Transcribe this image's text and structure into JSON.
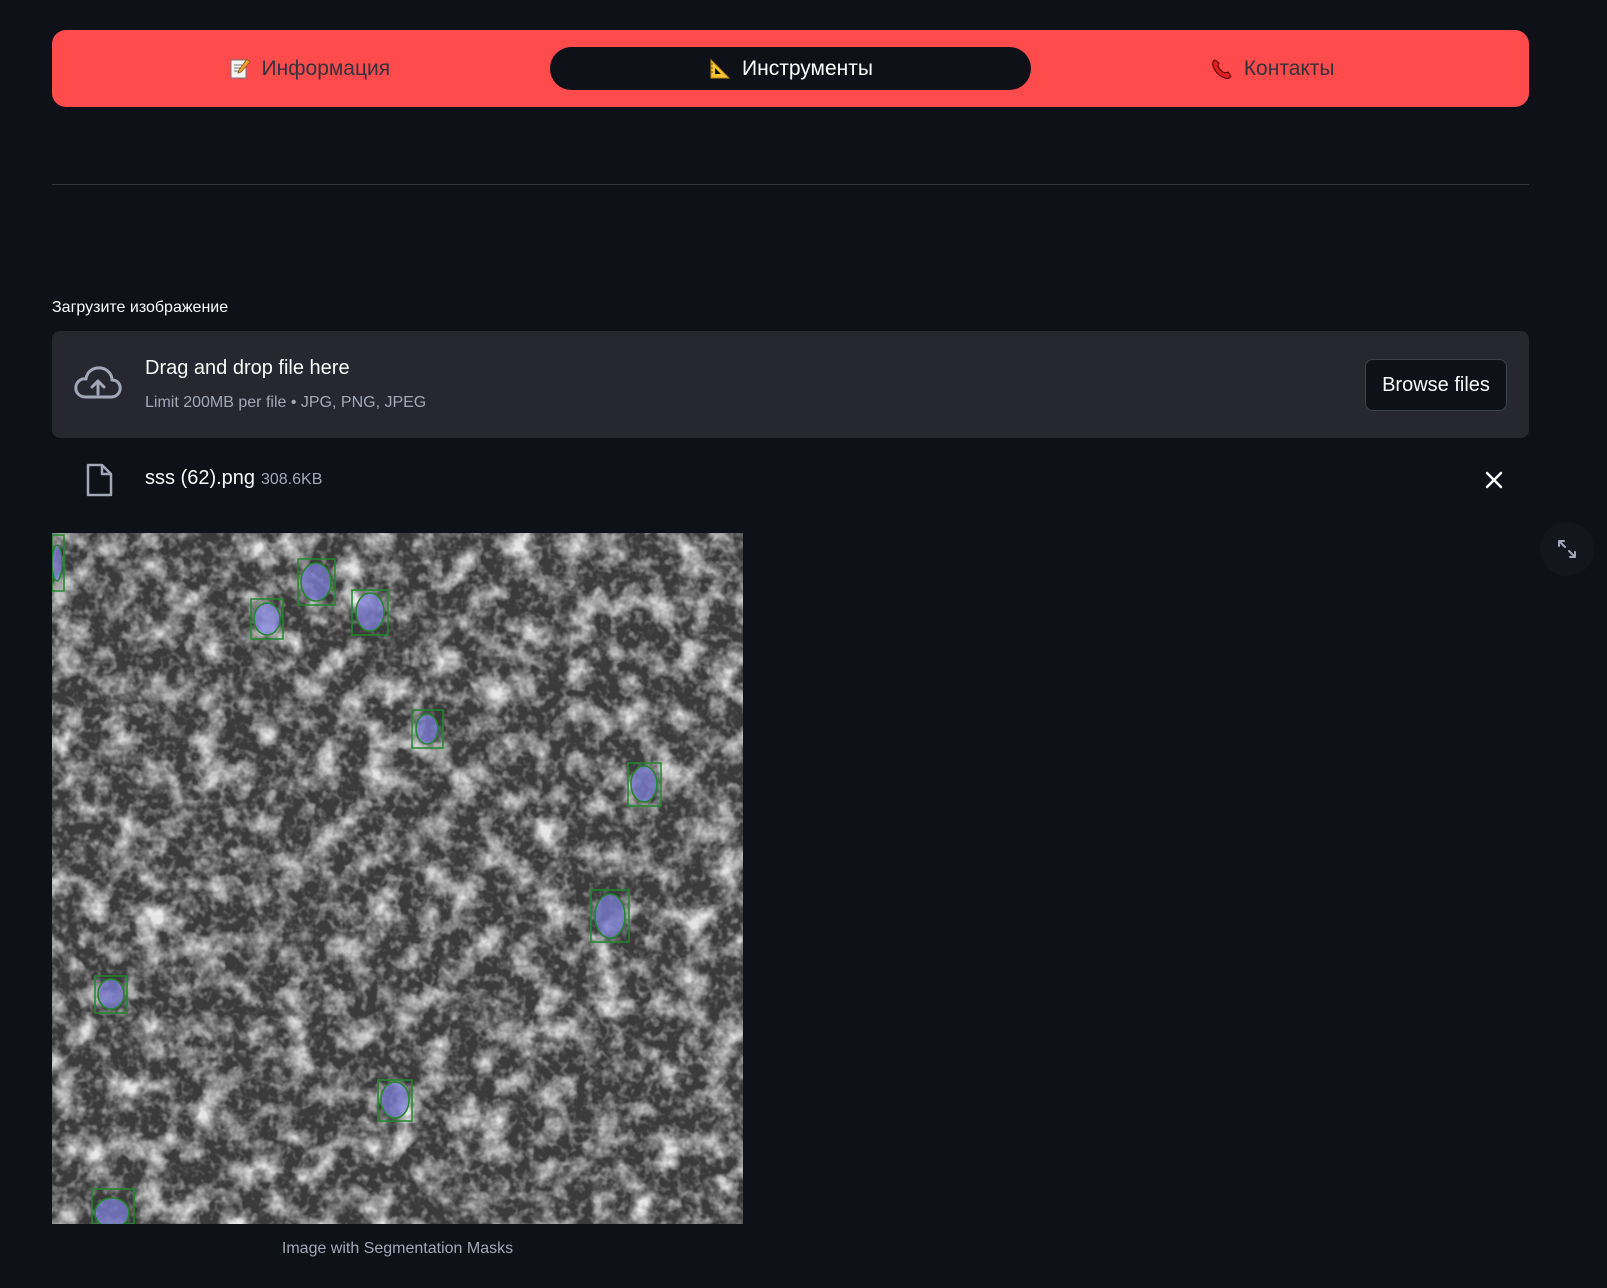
{
  "nav": {
    "items": [
      {
        "icon": "memo-icon",
        "label": "Информация",
        "active": false
      },
      {
        "icon": "triangular-ruler-icon",
        "label": "Инструменты",
        "active": true
      },
      {
        "icon": "telephone-icon",
        "label": "Контакты",
        "active": false
      }
    ],
    "accent_color": "#ff4b4b"
  },
  "upload": {
    "label": "Загрузите изображение",
    "dropzone_title": "Drag and drop file here",
    "dropzone_subtitle": "Limit 200MB per file • JPG, PNG, JPEG",
    "browse_label": "Browse files"
  },
  "file": {
    "name": "sss (62).png",
    "size": "308.6KB"
  },
  "image": {
    "caption": "Image with Segmentation Masks"
  }
}
